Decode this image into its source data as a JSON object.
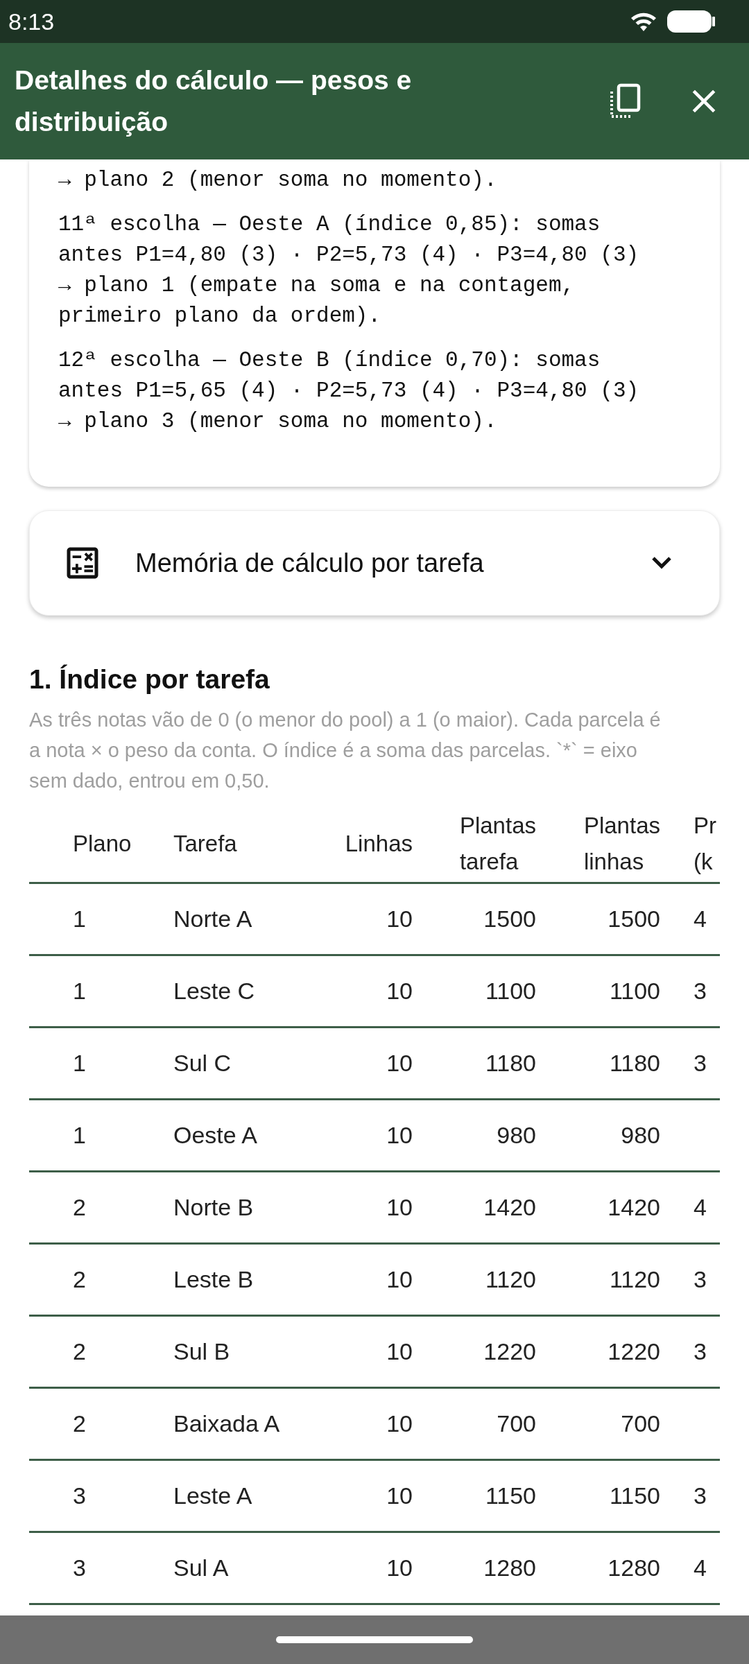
{
  "status_bar": {
    "time": "8:13"
  },
  "app_bar": {
    "title": "Detalhes do cálculo — pesos e distribuição"
  },
  "log_card": {
    "entries": [
      "→ plano 2 (menor soma no momento).",
      "11ª escolha — Oeste A (índice 0,85): somas antes P1=4,80 (3) · P2=5,73 (4) · P3=4,80 (3) → plano 1 (empate na soma e na contagem, primeiro plano da ordem).",
      "12ª escolha — Oeste B (índice 0,70): somas antes P1=5,65 (4) · P2=5,73 (4) · P3=4,80 (3) → plano 3 (menor soma no momento)."
    ]
  },
  "expander": {
    "label": "Memória de cálculo por tarefa",
    "expanded": false
  },
  "section": {
    "heading": "1. Índice por tarefa",
    "description": "As três notas vão de 0 (o menor do pool) a 1 (o maior). Cada parcela é a nota × o peso da conta. O índice é a soma das parcelas. `*` = eixo sem dado, entrou em 0,50."
  },
  "table": {
    "columns": [
      "Plano",
      "Tarefa",
      "Linhas",
      "Plantas tarefa",
      "Plantas linhas",
      "Pr (k"
    ],
    "rows": [
      [
        "1",
        "Norte A",
        "10",
        "1500",
        "1500",
        "4"
      ],
      [
        "1",
        "Leste C",
        "10",
        "1100",
        "1100",
        "3"
      ],
      [
        "1",
        "Sul C",
        "10",
        "1180",
        "1180",
        "3"
      ],
      [
        "1",
        "Oeste A",
        "10",
        "980",
        "980",
        ""
      ],
      [
        "2",
        "Norte B",
        "10",
        "1420",
        "1420",
        "4"
      ],
      [
        "2",
        "Leste B",
        "10",
        "1120",
        "1120",
        "3"
      ],
      [
        "2",
        "Sul B",
        "10",
        "1220",
        "1220",
        "3"
      ],
      [
        "2",
        "Baixada A",
        "10",
        "700",
        "700",
        ""
      ],
      [
        "3",
        "Leste A",
        "10",
        "1150",
        "1150",
        "3"
      ],
      [
        "3",
        "Sul A",
        "10",
        "1280",
        "1280",
        "4"
      ]
    ]
  }
}
